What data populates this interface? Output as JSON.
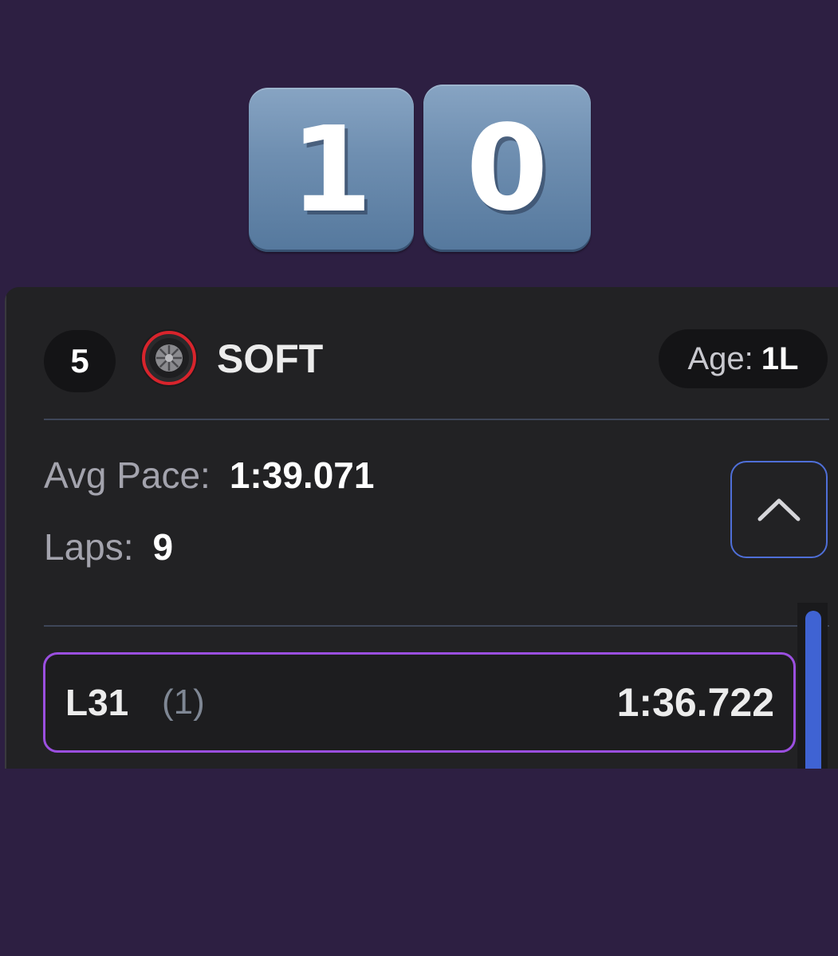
{
  "tiles": {
    "digits": [
      "1",
      "0"
    ]
  },
  "stint": {
    "number": "5",
    "compound": "SOFT",
    "tyre_icon": "soft-tyre-icon",
    "age_label": "Age:",
    "age_value": "1L",
    "avg_pace_label": "Avg Pace:",
    "avg_pace_value": "1:39.071",
    "laps_label": "Laps:",
    "laps_value": "9",
    "collapse_icon": "chevron-up-icon"
  },
  "laps": [
    {
      "lap": "L31",
      "position": "(1)",
      "time": "1:36.722"
    }
  ],
  "colors": {
    "background": "#2d1f42",
    "card": "#222224",
    "accent_blue": "#4f6fd8",
    "fastest_lap_purple": "#9b4fe0",
    "soft_tyre_red": "#d8242c"
  }
}
